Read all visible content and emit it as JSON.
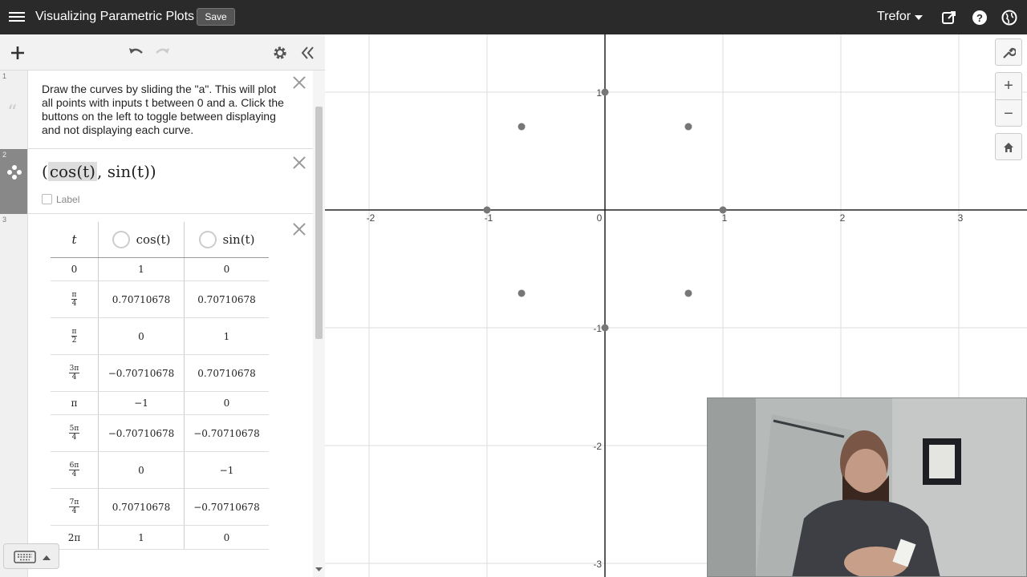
{
  "app": {
    "title": "Visualizing Parametric Plots",
    "save_label": "Save",
    "user_name": "Trefor"
  },
  "toolbar": {
    "add_label": "+",
    "icons": [
      "plus-icon",
      "undo-icon",
      "redo-icon",
      "gear-icon",
      "collapse-icon"
    ]
  },
  "expressions": {
    "note": {
      "number": "1",
      "text": "Draw the curves by sliding the \"a\". This will plot all points with inputs t between 0 and a. Click the buttons on the left to toggle between displaying and not displaying each curve."
    },
    "formula": {
      "number": "2",
      "open": "(",
      "part1": "cos(t)",
      "comma": ",",
      "part2": "sin(t)",
      "close": ")",
      "label_checkbox": "Label"
    },
    "table": {
      "number": "3",
      "headers": [
        "t",
        "cos(t)",
        "sin(t)"
      ],
      "rows": [
        {
          "t_num": "0",
          "t_den": "",
          "cos": "1",
          "sin": "0"
        },
        {
          "t_num": "π",
          "t_den": "4",
          "cos": "0.70710678",
          "sin": "0.70710678"
        },
        {
          "t_num": "π",
          "t_den": "2",
          "cos": "0",
          "sin": "1"
        },
        {
          "t_num": "3π",
          "t_den": "4",
          "cos": "−0.70710678",
          "sin": "0.70710678"
        },
        {
          "t_num": "π",
          "t_den": "",
          "cos": "−1",
          "sin": "0"
        },
        {
          "t_num": "5π",
          "t_den": "4",
          "cos": "−0.70710678",
          "sin": "−0.70710678"
        },
        {
          "t_num": "6π",
          "t_den": "4",
          "cos": "0",
          "sin": "−1"
        },
        {
          "t_num": "7π",
          "t_den": "4",
          "cos": "0.70710678",
          "sin": "−0.70710678"
        },
        {
          "t_num": "2π",
          "t_den": "",
          "cos": "1",
          "sin": "0"
        }
      ]
    }
  },
  "graph": {
    "x_ticks": [
      "-2",
      "-1",
      "0",
      "1",
      "2",
      "3"
    ],
    "y_ticks": [
      "1",
      "-1",
      "-2",
      "-3"
    ],
    "tool_icons": [
      "wrench-icon",
      "zoom-in-icon",
      "zoom-out-icon",
      "home-icon"
    ],
    "zoom_in_label": "+",
    "zoom_out_label": "−",
    "point_color": "#777777",
    "points": [
      {
        "x": 1,
        "y": 0
      },
      {
        "x": 0.70710678,
        "y": 0.70710678
      },
      {
        "x": 0,
        "y": 1
      },
      {
        "x": -0.70710678,
        "y": 0.70710678
      },
      {
        "x": -1,
        "y": 0
      },
      {
        "x": -0.70710678,
        "y": -0.70710678
      },
      {
        "x": 0,
        "y": -1
      },
      {
        "x": 0.70710678,
        "y": -0.70710678
      }
    ]
  },
  "colors": {
    "topbar": "#2a2a2a",
    "accent": "#2a2a2a"
  }
}
